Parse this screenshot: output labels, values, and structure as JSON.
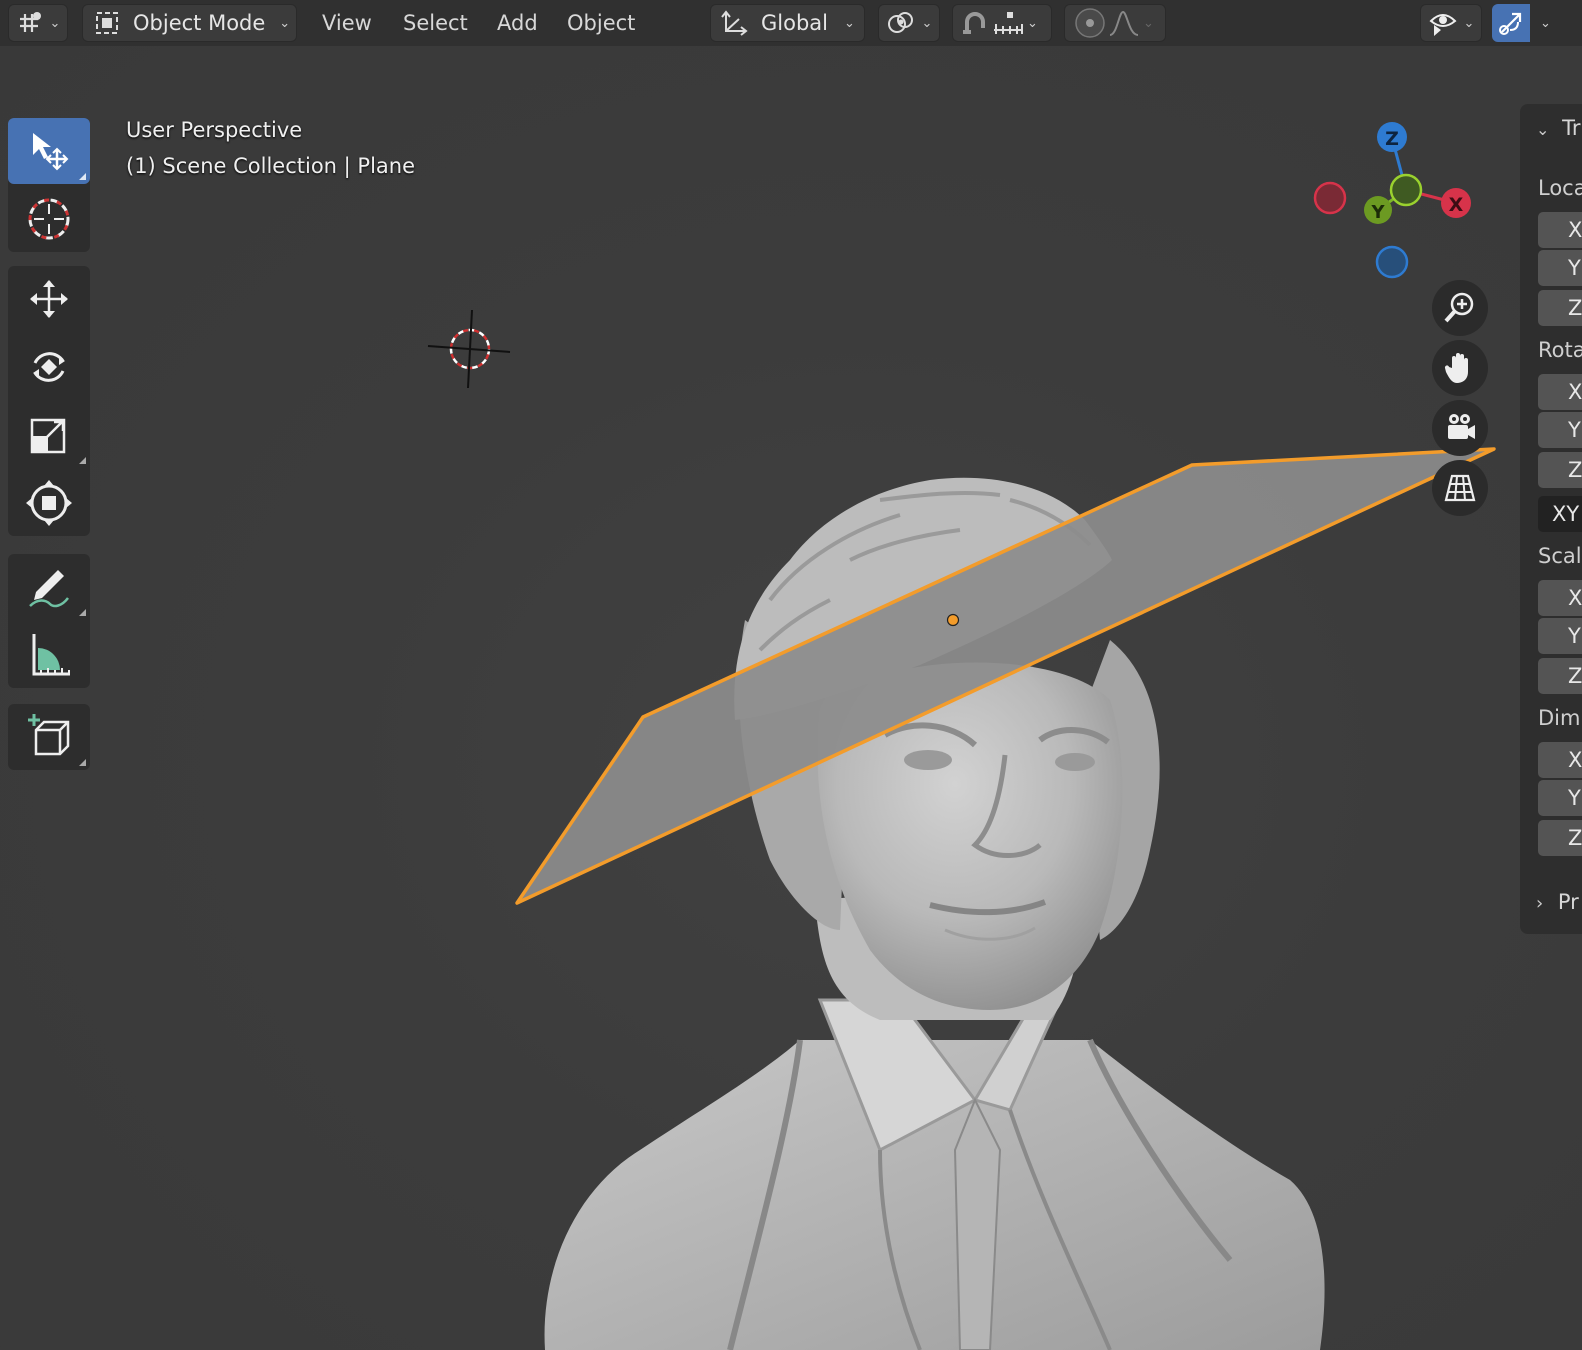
{
  "header": {
    "editor_type_icon": "editor-type-icon",
    "mode_label": "Object Mode",
    "menus": [
      "View",
      "Select",
      "Add",
      "Object"
    ],
    "transform_orientation": "Global",
    "icons": {
      "pivot": "pivot-point-icon",
      "snap": "snap-magnet-icon",
      "snap_increment": "snap-increment-icon",
      "proportional": "proportional-editing-icon",
      "falloff": "falloff-curve-icon",
      "visibility": "object-visibility-icon",
      "gizmo": "gizmo-toggle-icon"
    }
  },
  "viewport": {
    "view_name": "User Perspective",
    "collection_info": "(1) Scene Collection | Plane"
  },
  "gizmo": {
    "z_label": "Z",
    "y_label": "Y",
    "x_label": "X",
    "colors": {
      "x": "#d7334a",
      "y": "#7db62a",
      "z": "#2e7bd1"
    }
  },
  "toolbar": {
    "tools": [
      "select-box",
      "cursor",
      "move",
      "rotate",
      "scale",
      "transform",
      "annotate",
      "measure",
      "add-cube"
    ]
  },
  "nav": [
    "zoom",
    "pan",
    "camera",
    "perspective-toggle"
  ],
  "npanel": {
    "transform_title": "Tr",
    "location_label": "Loca",
    "rotation_label": "Rota",
    "scale_label": "Scal",
    "dimensions_label": "Dim",
    "axes": [
      "X",
      "Y",
      "Z"
    ],
    "rotation_mode": "XY",
    "properties_title": "Pr"
  },
  "colors": {
    "selection_outline": "#f39c2b",
    "active_tool": "#4772b3",
    "background": "#3d3d3d"
  }
}
